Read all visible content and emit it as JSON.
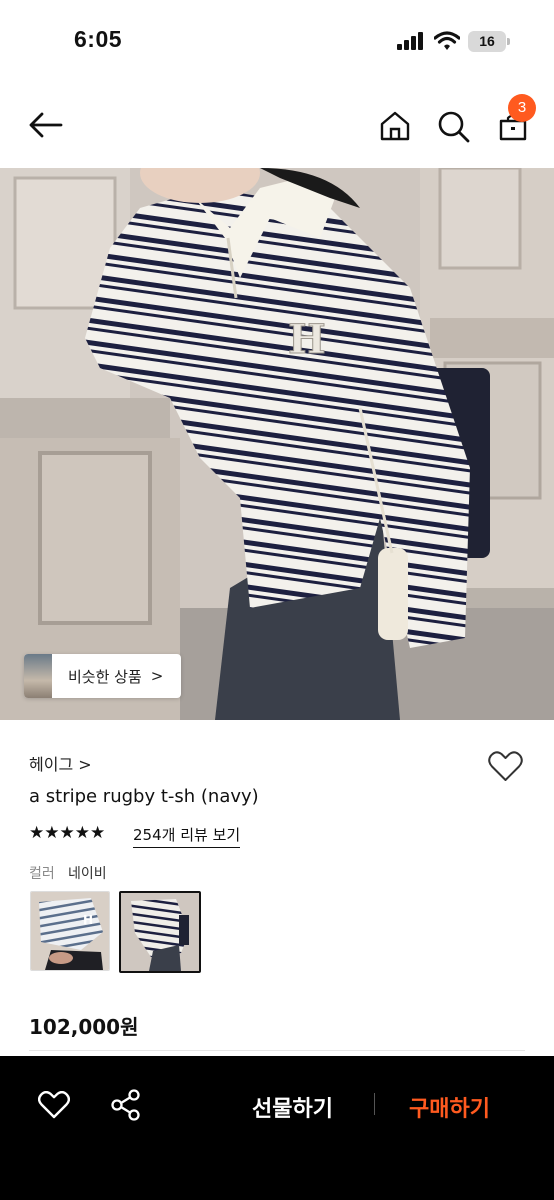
{
  "status_bar": {
    "time": "6:05",
    "battery": "16"
  },
  "header": {
    "cart_count": "3"
  },
  "product": {
    "similar_label": "비슷한 상품",
    "similar_chevron": ">",
    "brand": "헤이그 >",
    "title": "a stripe rugby t-sh (navy)",
    "stars": "★★★★★",
    "rating_value": 5,
    "review_link": "254개 리뷰 보기",
    "color_label": "컬러",
    "color_value": "네이비",
    "price": "102,000원"
  },
  "bottom_bar": {
    "gift_label": "선물하기",
    "buy_label": "구매하기"
  },
  "colors": {
    "accent": "#ff5a1f",
    "bar": "#000000"
  }
}
